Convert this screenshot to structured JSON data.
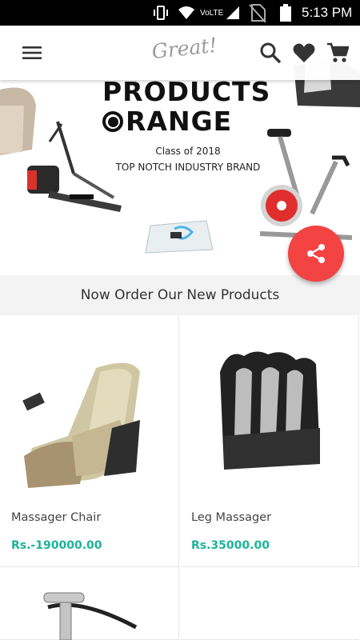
{
  "status_bar": {
    "network_label": "VoLTE",
    "time": "5:13 PM"
  },
  "app_bar": {
    "logo_text": "Great!",
    "icons": [
      "menu-icon",
      "search-icon",
      "heart-icon",
      "cart-icon"
    ]
  },
  "banner": {
    "title_line1": "PRODUCTS",
    "title_line2": "RANGE",
    "subtitle": "Class of 2018",
    "tagline": "TOP NOTCH INDUSTRY BRAND"
  },
  "section": {
    "title": "Now Order Our New Products"
  },
  "products": [
    {
      "name": "Massager Chair",
      "price": "Rs.-190000.00"
    },
    {
      "name": "Leg Massager",
      "price": "Rs.35000.00"
    }
  ],
  "colors": {
    "accent_fab": "#f44343",
    "price": "#1bb39a",
    "status_bar": "#000000"
  }
}
